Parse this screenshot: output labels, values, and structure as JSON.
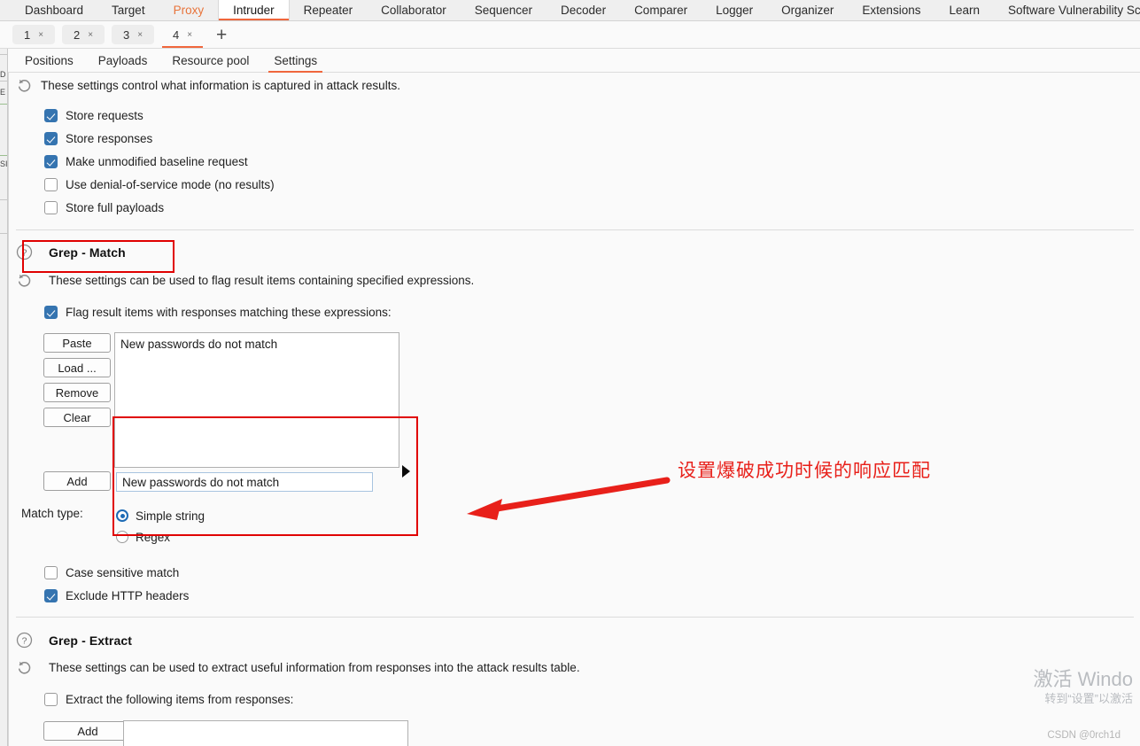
{
  "app": {
    "main_nav": [
      {
        "label": "Dashboard",
        "state": "normal"
      },
      {
        "label": "Target",
        "state": "normal"
      },
      {
        "label": "Proxy",
        "state": "accent"
      },
      {
        "label": "Intruder",
        "state": "active"
      },
      {
        "label": "Repeater",
        "state": "normal"
      },
      {
        "label": "Collaborator",
        "state": "normal"
      },
      {
        "label": "Sequencer",
        "state": "normal"
      },
      {
        "label": "Decoder",
        "state": "normal"
      },
      {
        "label": "Comparer",
        "state": "normal"
      },
      {
        "label": "Logger",
        "state": "normal"
      },
      {
        "label": "Organizer",
        "state": "normal"
      },
      {
        "label": "Extensions",
        "state": "normal"
      },
      {
        "label": "Learn",
        "state": "normal"
      },
      {
        "label": "Software Vulnerability Scanner",
        "state": "normal"
      }
    ],
    "attack_tabs": [
      {
        "label": "1",
        "close": "×",
        "active": false
      },
      {
        "label": "2",
        "close": "×",
        "active": false
      },
      {
        "label": "3",
        "close": "×",
        "active": false
      },
      {
        "label": "4",
        "close": "×",
        "active": true
      }
    ],
    "add_tab_label": "+",
    "sub_tabs": [
      {
        "label": "Positions",
        "active": false
      },
      {
        "label": "Payloads",
        "active": false
      },
      {
        "label": "Resource pool",
        "active": false
      },
      {
        "label": "Settings",
        "active": true
      }
    ],
    "accent_color": "#f0663c",
    "checkbox_color": "#3574b0",
    "annotation_color": "#e00000"
  },
  "attack_results": {
    "description": "These settings control what information is captured in attack results.",
    "checkboxes": [
      {
        "label": "Store requests",
        "checked": true
      },
      {
        "label": "Store responses",
        "checked": true
      },
      {
        "label": "Make unmodified baseline request",
        "checked": true
      },
      {
        "label": "Use denial-of-service mode (no results)",
        "checked": false
      },
      {
        "label": "Store full payloads",
        "checked": false
      }
    ]
  },
  "grep_match": {
    "title": "Grep - Match",
    "description": "These settings can be used to flag result items containing specified expressions.",
    "flag_checkbox": {
      "label": "Flag result items with responses matching these expressions:",
      "checked": true
    },
    "buttons": [
      "Paste",
      "Load ...",
      "Remove",
      "Clear"
    ],
    "add_button": "Add",
    "expressions": [
      "New passwords do not match"
    ],
    "new_expression_value": "New passwords do not match",
    "match_type_label": "Match type:",
    "match_types": [
      {
        "label": "Simple string",
        "selected": true
      },
      {
        "label": "Regex",
        "selected": false
      }
    ],
    "options": [
      {
        "label": "Case sensitive match",
        "checked": false
      },
      {
        "label": "Exclude HTTP headers",
        "checked": true
      }
    ]
  },
  "grep_extract": {
    "title": "Grep - Extract",
    "description": "These settings can be used to extract useful information from responses into the attack results table.",
    "extract_checkbox": {
      "label": "Extract the following items from responses:",
      "checked": false
    },
    "add_button": "Add",
    "items": []
  },
  "annotations": {
    "note_text": "设置爆破成功时候的响应匹配",
    "boxes": [
      "grep-match-title",
      "match-expression-area"
    ]
  },
  "watermark": {
    "line1": "激活 Windo",
    "line2": "转到“设置”以激活",
    "credit": "CSDN @0rch1d"
  },
  "left_sliver": {
    "labels": [
      "D",
      "E",
      "SI"
    ]
  }
}
